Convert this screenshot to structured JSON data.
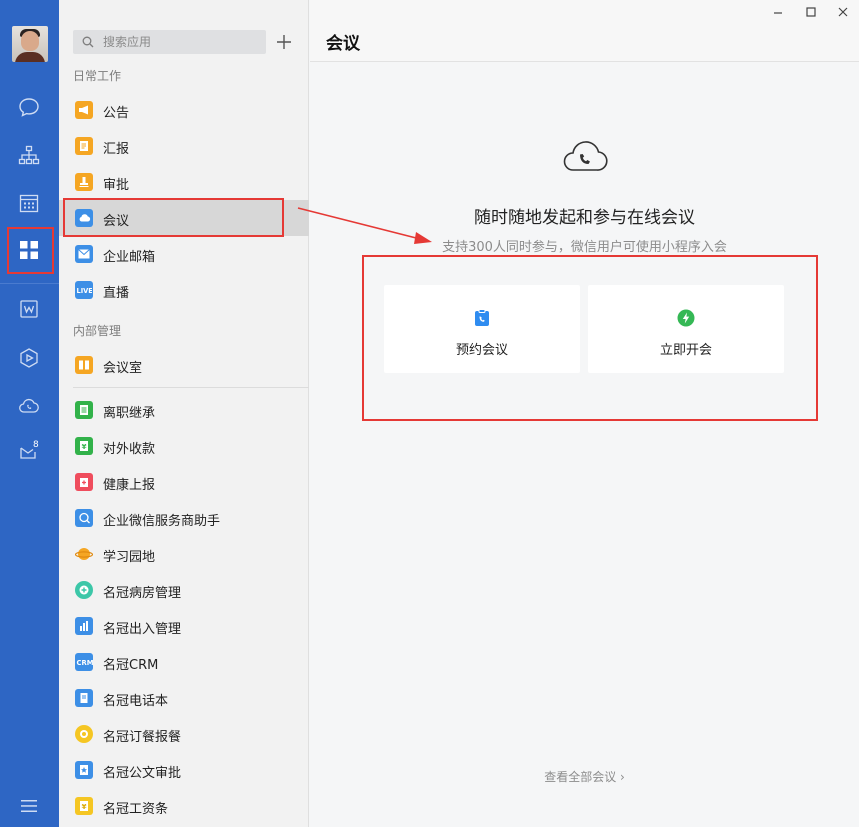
{
  "search": {
    "placeholder": "搜索应用"
  },
  "rail": {
    "mail_badge": "8"
  },
  "sections": {
    "daily": "日常工作",
    "internal": "内部管理"
  },
  "apps": {
    "daily": [
      {
        "label": "公告",
        "icon": "announcement-icon",
        "color": "#f5a623"
      },
      {
        "label": "汇报",
        "icon": "report-icon",
        "color": "#f5a623"
      },
      {
        "label": "审批",
        "icon": "approval-icon",
        "color": "#f5a623"
      },
      {
        "label": "会议",
        "icon": "meeting-icon",
        "color": "#3d8fe6"
      },
      {
        "label": "企业邮箱",
        "icon": "mail-icon",
        "color": "#3d8fe6"
      },
      {
        "label": "直播",
        "icon": "live-icon",
        "color": "#3d8fe6"
      }
    ],
    "internal": [
      {
        "label": "会议室",
        "icon": "meeting-room-icon",
        "color": "#f5a623"
      },
      {
        "label": "离职继承",
        "icon": "resign-inherit-icon",
        "color": "#32b24a"
      },
      {
        "label": "对外收款",
        "icon": "payment-icon",
        "color": "#32b24a"
      },
      {
        "label": "健康上报",
        "icon": "health-report-icon",
        "color": "#ef4d5d"
      },
      {
        "label": "企业微信服务商助手",
        "icon": "service-assistant-icon",
        "color": "#3d8fe6"
      },
      {
        "label": "学习园地",
        "icon": "planet-icon",
        "color": "#f5a623"
      },
      {
        "label": "名冠病房管理",
        "icon": "ward-icon",
        "color": "#3cc7a8"
      },
      {
        "label": "名冠出入管理",
        "icon": "access-icon",
        "color": "#3d8fe6"
      },
      {
        "label": "名冠CRM",
        "icon": "crm-icon",
        "color": "#3d8fe6"
      },
      {
        "label": "名冠电话本",
        "icon": "phonebook-icon",
        "color": "#3d8fe6"
      },
      {
        "label": "名冠订餐报餐",
        "icon": "meal-order-icon",
        "color": "#f5c623"
      },
      {
        "label": "名冠公文审批",
        "icon": "document-approval-icon",
        "color": "#3d8fe6"
      },
      {
        "label": "名冠工资条",
        "icon": "payslip-icon",
        "color": "#f5c623"
      }
    ]
  },
  "main": {
    "title": "会议",
    "hero_title": "随时随地发起和参与在线会议",
    "hero_subtitle": "支持300人同时参与，微信用户可使用小程序入会",
    "cards": [
      {
        "label": "预约会议",
        "icon": "schedule-meeting-icon",
        "color": "#2f8cf0"
      },
      {
        "label": "立即开会",
        "icon": "start-meeting-icon",
        "color": "#35b855"
      }
    ],
    "view_all": "查看全部会议 ›"
  }
}
